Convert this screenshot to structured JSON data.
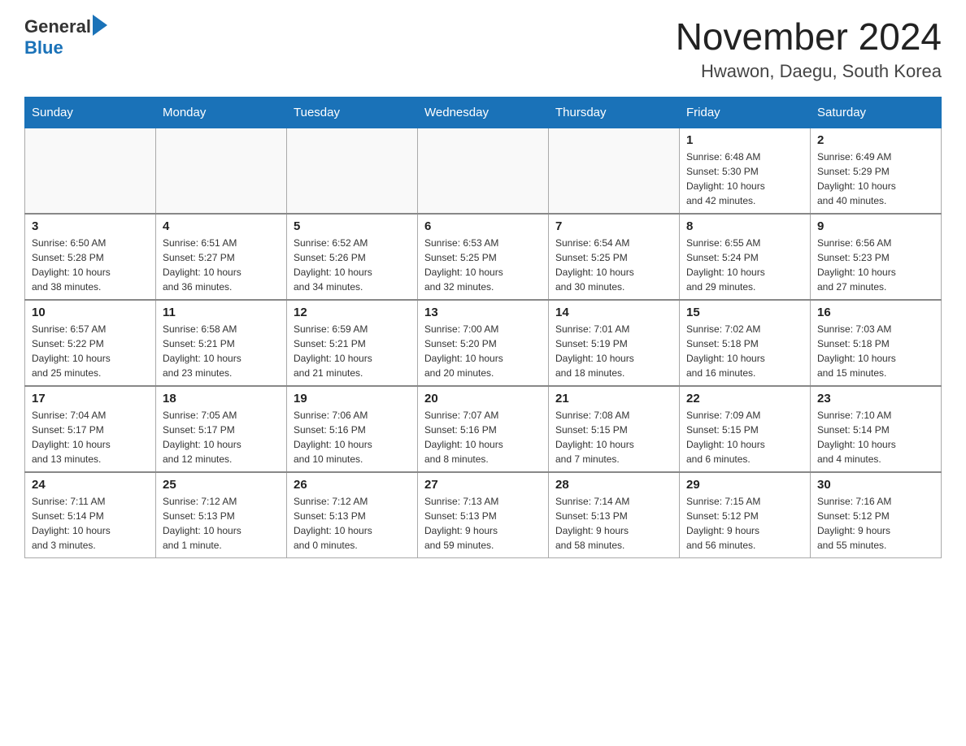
{
  "logo": {
    "general": "General",
    "blue": "Blue"
  },
  "header": {
    "title": "November 2024",
    "subtitle": "Hwawon, Daegu, South Korea"
  },
  "weekdays": [
    "Sunday",
    "Monday",
    "Tuesday",
    "Wednesday",
    "Thursday",
    "Friday",
    "Saturday"
  ],
  "weeks": [
    [
      {
        "day": "",
        "info": ""
      },
      {
        "day": "",
        "info": ""
      },
      {
        "day": "",
        "info": ""
      },
      {
        "day": "",
        "info": ""
      },
      {
        "day": "",
        "info": ""
      },
      {
        "day": "1",
        "info": "Sunrise: 6:48 AM\nSunset: 5:30 PM\nDaylight: 10 hours\nand 42 minutes."
      },
      {
        "day": "2",
        "info": "Sunrise: 6:49 AM\nSunset: 5:29 PM\nDaylight: 10 hours\nand 40 minutes."
      }
    ],
    [
      {
        "day": "3",
        "info": "Sunrise: 6:50 AM\nSunset: 5:28 PM\nDaylight: 10 hours\nand 38 minutes."
      },
      {
        "day": "4",
        "info": "Sunrise: 6:51 AM\nSunset: 5:27 PM\nDaylight: 10 hours\nand 36 minutes."
      },
      {
        "day": "5",
        "info": "Sunrise: 6:52 AM\nSunset: 5:26 PM\nDaylight: 10 hours\nand 34 minutes."
      },
      {
        "day": "6",
        "info": "Sunrise: 6:53 AM\nSunset: 5:25 PM\nDaylight: 10 hours\nand 32 minutes."
      },
      {
        "day": "7",
        "info": "Sunrise: 6:54 AM\nSunset: 5:25 PM\nDaylight: 10 hours\nand 30 minutes."
      },
      {
        "day": "8",
        "info": "Sunrise: 6:55 AM\nSunset: 5:24 PM\nDaylight: 10 hours\nand 29 minutes."
      },
      {
        "day": "9",
        "info": "Sunrise: 6:56 AM\nSunset: 5:23 PM\nDaylight: 10 hours\nand 27 minutes."
      }
    ],
    [
      {
        "day": "10",
        "info": "Sunrise: 6:57 AM\nSunset: 5:22 PM\nDaylight: 10 hours\nand 25 minutes."
      },
      {
        "day": "11",
        "info": "Sunrise: 6:58 AM\nSunset: 5:21 PM\nDaylight: 10 hours\nand 23 minutes."
      },
      {
        "day": "12",
        "info": "Sunrise: 6:59 AM\nSunset: 5:21 PM\nDaylight: 10 hours\nand 21 minutes."
      },
      {
        "day": "13",
        "info": "Sunrise: 7:00 AM\nSunset: 5:20 PM\nDaylight: 10 hours\nand 20 minutes."
      },
      {
        "day": "14",
        "info": "Sunrise: 7:01 AM\nSunset: 5:19 PM\nDaylight: 10 hours\nand 18 minutes."
      },
      {
        "day": "15",
        "info": "Sunrise: 7:02 AM\nSunset: 5:18 PM\nDaylight: 10 hours\nand 16 minutes."
      },
      {
        "day": "16",
        "info": "Sunrise: 7:03 AM\nSunset: 5:18 PM\nDaylight: 10 hours\nand 15 minutes."
      }
    ],
    [
      {
        "day": "17",
        "info": "Sunrise: 7:04 AM\nSunset: 5:17 PM\nDaylight: 10 hours\nand 13 minutes."
      },
      {
        "day": "18",
        "info": "Sunrise: 7:05 AM\nSunset: 5:17 PM\nDaylight: 10 hours\nand 12 minutes."
      },
      {
        "day": "19",
        "info": "Sunrise: 7:06 AM\nSunset: 5:16 PM\nDaylight: 10 hours\nand 10 minutes."
      },
      {
        "day": "20",
        "info": "Sunrise: 7:07 AM\nSunset: 5:16 PM\nDaylight: 10 hours\nand 8 minutes."
      },
      {
        "day": "21",
        "info": "Sunrise: 7:08 AM\nSunset: 5:15 PM\nDaylight: 10 hours\nand 7 minutes."
      },
      {
        "day": "22",
        "info": "Sunrise: 7:09 AM\nSunset: 5:15 PM\nDaylight: 10 hours\nand 6 minutes."
      },
      {
        "day": "23",
        "info": "Sunrise: 7:10 AM\nSunset: 5:14 PM\nDaylight: 10 hours\nand 4 minutes."
      }
    ],
    [
      {
        "day": "24",
        "info": "Sunrise: 7:11 AM\nSunset: 5:14 PM\nDaylight: 10 hours\nand 3 minutes."
      },
      {
        "day": "25",
        "info": "Sunrise: 7:12 AM\nSunset: 5:13 PM\nDaylight: 10 hours\nand 1 minute."
      },
      {
        "day": "26",
        "info": "Sunrise: 7:12 AM\nSunset: 5:13 PM\nDaylight: 10 hours\nand 0 minutes."
      },
      {
        "day": "27",
        "info": "Sunrise: 7:13 AM\nSunset: 5:13 PM\nDaylight: 9 hours\nand 59 minutes."
      },
      {
        "day": "28",
        "info": "Sunrise: 7:14 AM\nSunset: 5:13 PM\nDaylight: 9 hours\nand 58 minutes."
      },
      {
        "day": "29",
        "info": "Sunrise: 7:15 AM\nSunset: 5:12 PM\nDaylight: 9 hours\nand 56 minutes."
      },
      {
        "day": "30",
        "info": "Sunrise: 7:16 AM\nSunset: 5:12 PM\nDaylight: 9 hours\nand 55 minutes."
      }
    ]
  ]
}
